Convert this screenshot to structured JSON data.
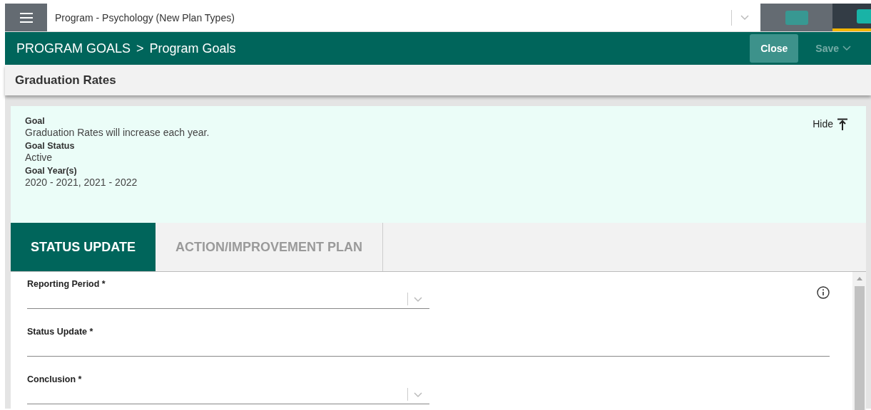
{
  "top_bar": {
    "program_select": {
      "value": "Program - Psychology (New Plan Types)"
    }
  },
  "header": {
    "section": "PROGRAM GOALS",
    "separator": ">",
    "page": "Program Goals",
    "buttons": [
      {
        "label": "Close",
        "kind": "primary",
        "disabled": false
      },
      {
        "label": "Save",
        "kind": "menu",
        "disabled": true
      }
    ]
  },
  "title": "Graduation Rates",
  "goal_panel": {
    "hide_label": "Hide",
    "details": [
      {
        "label": "Goal",
        "value": "Graduation Rates will increase each year."
      },
      {
        "label": "Goal Status",
        "value": "Active"
      },
      {
        "label": "Goal Year(s)",
        "value": "2020 - 2021, 2021 - 2022"
      }
    ]
  },
  "tabs": [
    {
      "label": "STATUS UPDATE",
      "selected": true
    },
    {
      "label": "ACTION/IMPROVEMENT PLAN",
      "selected": false
    }
  ],
  "form": {
    "fields": [
      {
        "label": "Reporting Period *",
        "kind": "select",
        "info": true
      },
      {
        "label": "Status Update *",
        "kind": "text",
        "info": false
      },
      {
        "label": "Conclusion *",
        "kind": "select",
        "info": false
      }
    ]
  }
}
